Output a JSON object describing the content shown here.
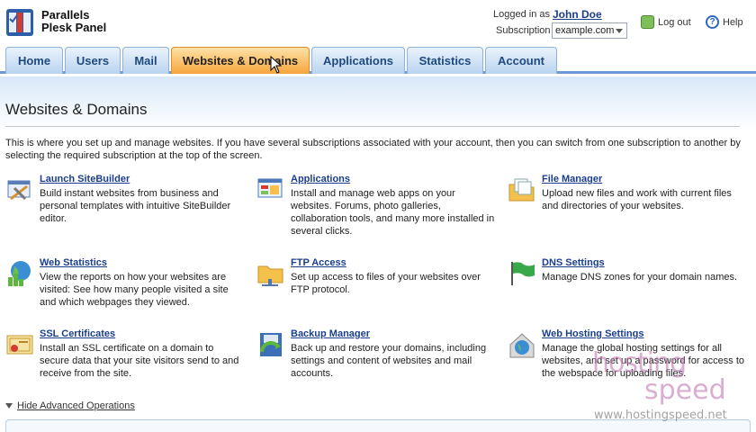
{
  "brand": {
    "line1": "Parallels",
    "line2": "Plesk Panel"
  },
  "header": {
    "logged_in_label": "Logged in as",
    "user": "John Doe",
    "subscription_label": "Subscription",
    "subscription_value": "example.com",
    "logout": "Log out",
    "help": "Help"
  },
  "tabs": [
    {
      "label": "Home"
    },
    {
      "label": "Users"
    },
    {
      "label": "Mail"
    },
    {
      "label": "Websites & Domains",
      "active": true
    },
    {
      "label": "Applications"
    },
    {
      "label": "Statistics"
    },
    {
      "label": "Account"
    }
  ],
  "page": {
    "title": "Websites & Domains",
    "intro": "This is where you set up and manage websites. If you have several subscriptions associated with your account, then you can switch from one subscription to another by selecting the required subscription at the top of the screen."
  },
  "items": [
    {
      "name": "Launch SiteBuilder",
      "desc": "Build instant websites from business and personal templates with intuitive SiteBuilder editor.",
      "icon": "sitebuilder-icon"
    },
    {
      "name": "Applications",
      "desc": "Install and manage web apps on your websites. Forums, photo galleries, collaboration tools, and many more installed in several clicks.",
      "icon": "applications-icon"
    },
    {
      "name": "File Manager",
      "desc": "Upload new files and work with current files and directories of your websites.",
      "icon": "file-manager-icon"
    },
    {
      "name": "Web Statistics",
      "desc": "View the reports on how your websites are visited: See how many people visited a site and which webpages they viewed.",
      "icon": "web-statistics-icon"
    },
    {
      "name": "FTP Access",
      "desc": "Set up access to files of your websites over FTP protocol.",
      "icon": "ftp-folder-icon"
    },
    {
      "name": "DNS Settings",
      "desc": "Manage DNS zones for your domain names.",
      "icon": "dns-flag-icon"
    },
    {
      "name": "SSL Certificates",
      "desc": "Install an SSL certificate on a domain to secure data that your site visitors send to and receive from the site.",
      "icon": "certificate-icon"
    },
    {
      "name": "Backup Manager",
      "desc": "Back up and restore your domains, including settings and content of websites and mail accounts.",
      "icon": "backup-icon"
    },
    {
      "name": "Web Hosting Settings",
      "desc": "Manage the global hosting settings for all websites, and set up a password for access to the webspace for uploading files.",
      "icon": "hosting-globe-icon"
    }
  ],
  "advanced": {
    "label": "Hide Advanced Operations"
  },
  "watermark": {
    "brand1": "hosting",
    "brand2": "speed",
    "url": "www.hostingspeed.net"
  },
  "colors": {
    "tab_active": "#f6a53c",
    "tab": "#b9d3ef",
    "link": "#1a3e8c"
  }
}
